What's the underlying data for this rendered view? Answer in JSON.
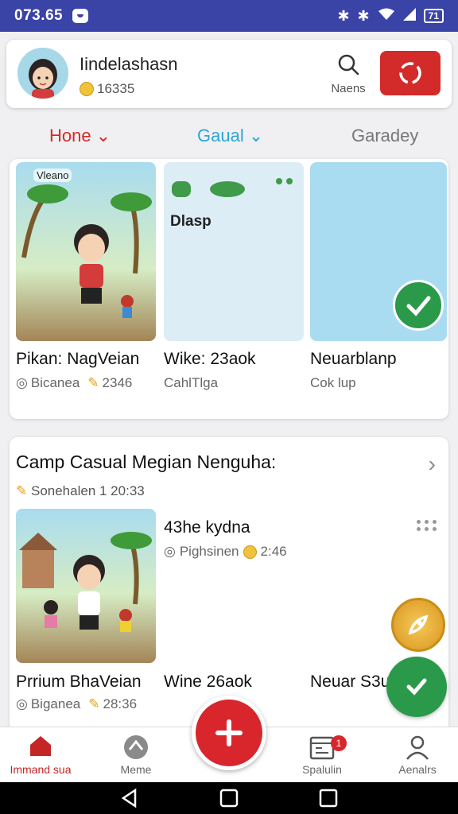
{
  "status_bar": {
    "time": "073.65",
    "battery": "71"
  },
  "header": {
    "username": "Iindelashasn",
    "coins": "16335",
    "search_label": "Naens"
  },
  "tabs": [
    {
      "label": "Hone"
    },
    {
      "label": "Gaual"
    },
    {
      "label": "Garadey"
    }
  ],
  "top_row": [
    {
      "badge": "Vleano",
      "title": "Pikan: NagVeian",
      "sub": "Bicanea",
      "count": "2346"
    },
    {
      "overlay": "Dlasp",
      "title": "Wike: 23aok",
      "sub": "CahlTlga"
    },
    {
      "title": "Neuarblanp",
      "sub": "Cok lup"
    }
  ],
  "feed": {
    "title": "Camp Casual Megian Nenguha:",
    "meta": "Sonehalen 1  20:33",
    "post_title": "43he kydna",
    "post_author": "Pighsinen",
    "post_time": "2:46",
    "items": [
      {
        "title": "Prrium BhaVeian",
        "sub": "Biganea",
        "count": "28:36"
      },
      {
        "title": "Wine  26aok"
      },
      {
        "title": "Neuar S3u"
      }
    ]
  },
  "bottom_nav": [
    {
      "label": "Immand sua"
    },
    {
      "label": "Meme"
    },
    {
      "label": "Spalulin",
      "badge": "1"
    },
    {
      "label": "Aenalrs"
    }
  ],
  "colors": {
    "primary": "#d32a2a",
    "accent": "#2aa6d8",
    "status_bar": "#3a43a6",
    "call": "#2a9a4a"
  }
}
